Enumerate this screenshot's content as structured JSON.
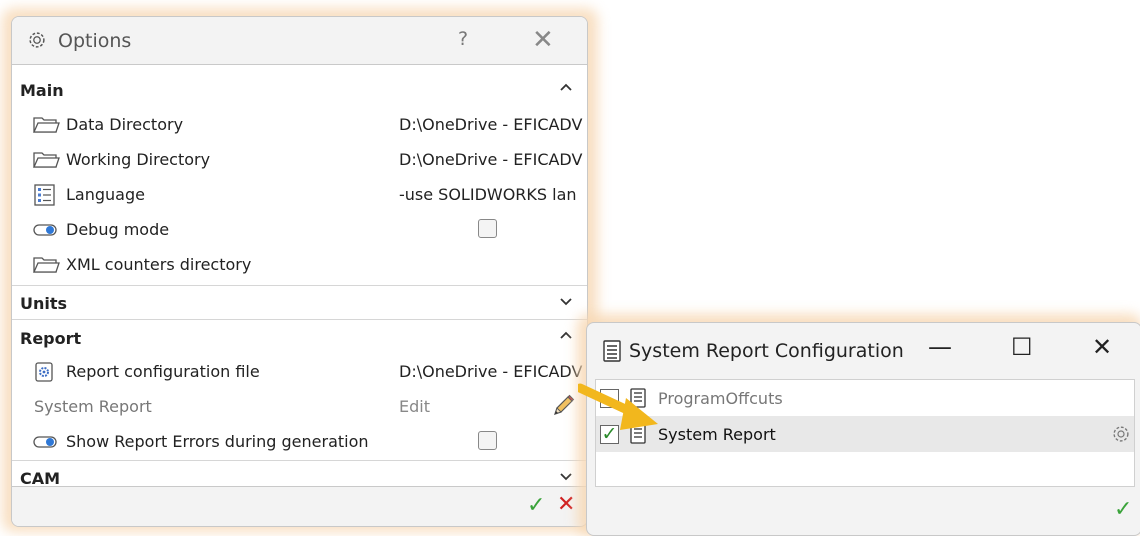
{
  "options": {
    "title": "Options",
    "help": "?",
    "close": "✕",
    "sections": {
      "main": {
        "label": "Main",
        "chevron": "^"
      },
      "units": {
        "label": "Units",
        "chevron": "⌄"
      },
      "report": {
        "label": "Report",
        "chevron": "^"
      },
      "cam": {
        "label": "CAM",
        "chevron": "⌄"
      }
    },
    "main_rows": {
      "data_dir": {
        "name": "Data Directory",
        "value": "D:\\OneDrive - EFICADV"
      },
      "work_dir": {
        "name": "Working Directory",
        "value": "D:\\OneDrive - EFICADV"
      },
      "language": {
        "name": "Language",
        "value": "-use SOLIDWORKS lan"
      },
      "debug": {
        "name": "Debug mode"
      },
      "xml": {
        "name": "XML counters directory"
      }
    },
    "report_rows": {
      "config_file": {
        "name": "Report configuration file",
        "value": "D:\\OneDrive - EFICADV"
      },
      "system_report": {
        "name": "System Report",
        "value": "Edit"
      },
      "show_errors": {
        "name": "Show Report Errors during generation"
      }
    },
    "footer": {
      "ok": "✓",
      "cancel": "✕"
    }
  },
  "system_report_config": {
    "title": "System Report Configuration",
    "minimize": "—",
    "maximize": "☐",
    "close": "✕",
    "items": [
      {
        "label": "ProgramOffcuts",
        "checked": false
      },
      {
        "label": "System Report",
        "checked": true
      }
    ],
    "checkmark": "✓",
    "ok": "✓"
  },
  "colors": {
    "accent_orange": "#f7d8b4",
    "arrow": "#f2b71d",
    "ok_green": "#3aa33a",
    "cancel_red": "#d02020"
  }
}
